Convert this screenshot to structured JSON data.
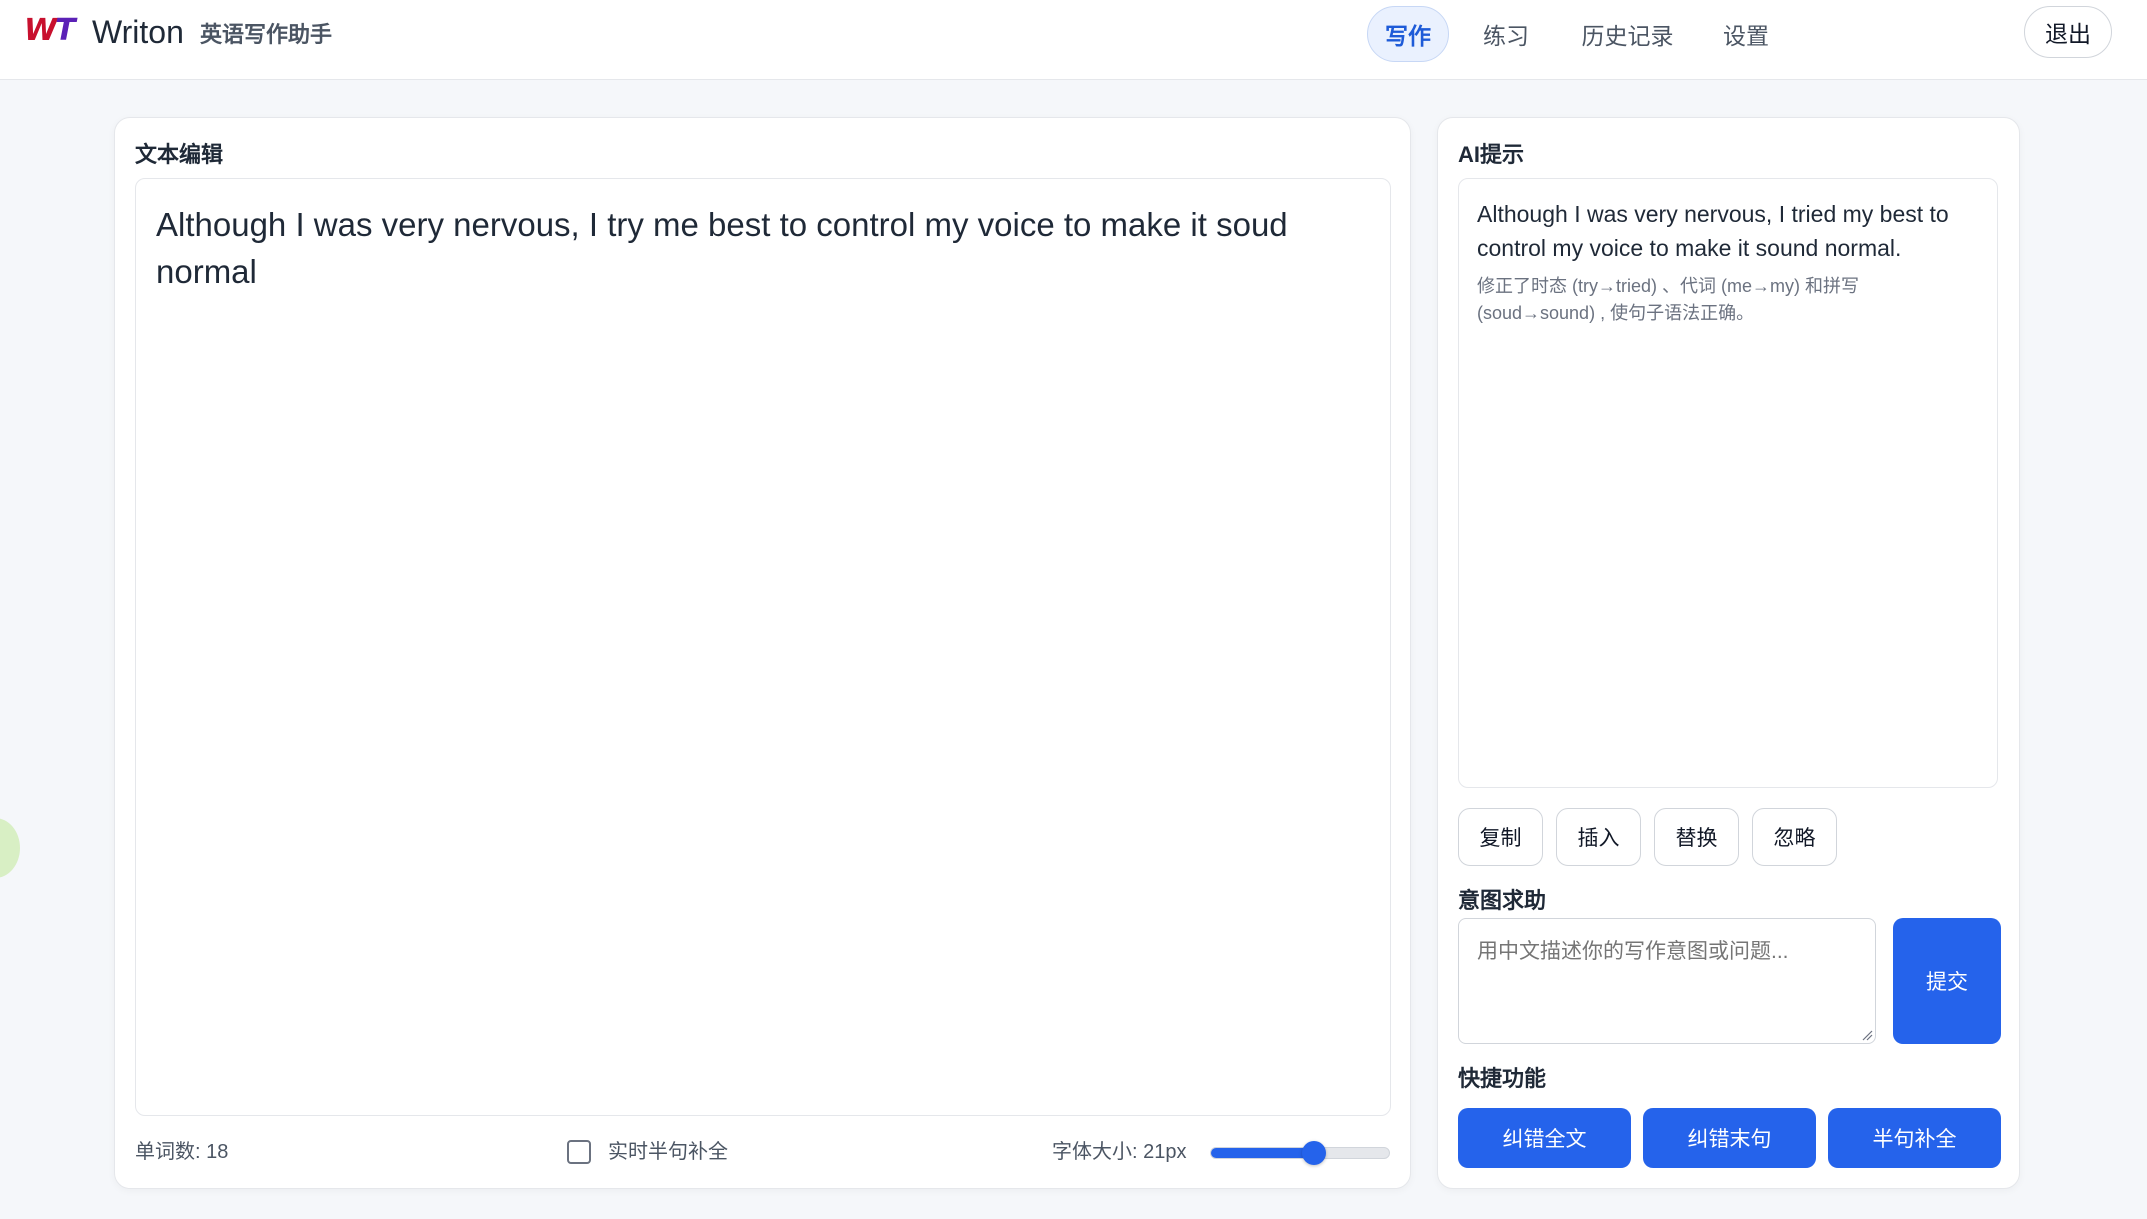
{
  "app": {
    "logo_w": "W",
    "logo_t": "T",
    "name": "Writon",
    "subtitle": "英语写作助手"
  },
  "nav": {
    "items": [
      {
        "label": "写作",
        "active": true
      },
      {
        "label": "练习",
        "active": false
      },
      {
        "label": "历史记录",
        "active": false
      },
      {
        "label": "设置",
        "active": false
      }
    ],
    "logout": "退出"
  },
  "editor": {
    "title": "文本编辑",
    "text": "Although I was very nervous, I try me best to control my voice to make it soud normal",
    "word_count_label": "单词数: 18",
    "realtime_label": "实时半句补全",
    "realtime_checked": false,
    "font_size_label": "字体大小: 21px",
    "font_size_level": 0.58
  },
  "ai": {
    "title": "AI提示",
    "suggestion": "Although I was very nervous, I tried my best to control my voice to make it sound normal.",
    "note": "修正了时态 (try→tried) 、代词 (me→my) 和拼写 (soud→sound) , 使句子语法正确。",
    "actions": [
      "复制",
      "插入",
      "替换",
      "忽略"
    ]
  },
  "intent": {
    "title": "意图求助",
    "placeholder": "用中文描述你的写作意图或问题...",
    "submit": "提交"
  },
  "quick": {
    "title": "快捷功能",
    "buttons": [
      "纠错全文",
      "纠错末句",
      "半句补全"
    ]
  },
  "colors": {
    "primary": "#2563eb",
    "logo_red": "#c8102e",
    "logo_purple": "#5b21b6"
  }
}
